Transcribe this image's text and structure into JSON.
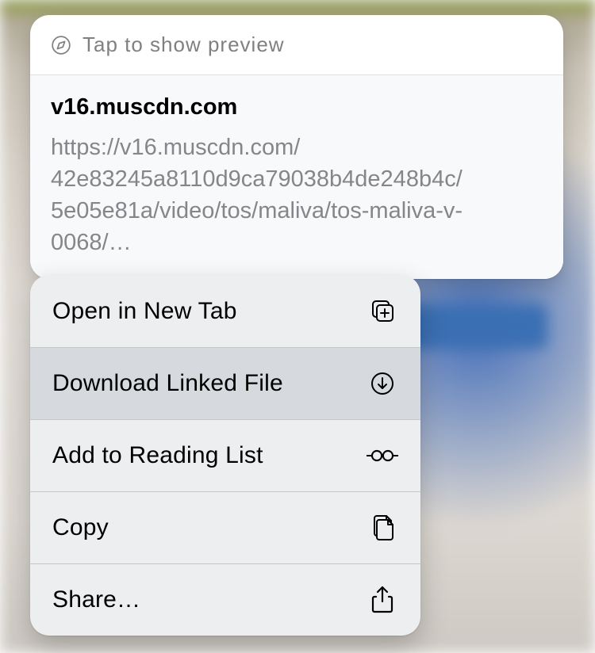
{
  "preview": {
    "hint": "Tap to show preview",
    "host": "v16.muscdn.com",
    "url_line1": "https://v16.muscdn.com/",
    "url_line2": "42e83245a8110d9ca79038b4de248b4c/",
    "url_line3": "5e05e81a/video/tos/maliva/tos-maliva-v-0068/…"
  },
  "menu": {
    "open_new_tab": "Open in New Tab",
    "download_linked_file": "Download Linked File",
    "add_reading_list": "Add to Reading List",
    "copy": "Copy",
    "share": "Share…"
  }
}
